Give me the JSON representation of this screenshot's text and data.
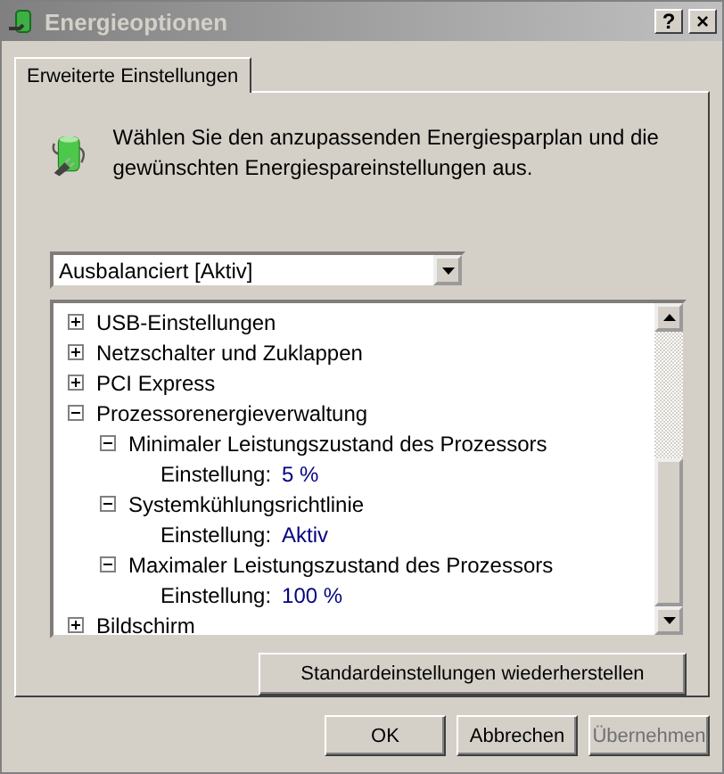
{
  "window": {
    "title": "Energieoptionen",
    "help_button": "?",
    "close_button": "×"
  },
  "tabs": [
    {
      "label": "Erweiterte Einstellungen",
      "selected": true
    }
  ],
  "description": "Wählen Sie den anzupassenden Energiesparplan und die gewünschten Energiespareinstellungen aus.",
  "plan_dropdown": {
    "value": "Ausbalanciert [Aktiv]"
  },
  "tree": [
    {
      "label": "USB-Einstellungen",
      "expanded": false
    },
    {
      "label": "Netzschalter und Zuklappen",
      "expanded": false
    },
    {
      "label": "PCI Express",
      "expanded": false
    },
    {
      "label": "Prozessorenergieverwaltung",
      "expanded": true,
      "children": [
        {
          "label": "Minimaler Leistungszustand des Prozessors",
          "expanded": true,
          "setting": {
            "label": "Einstellung:",
            "value": "5 %"
          }
        },
        {
          "label": "Systemkühlungsrichtlinie",
          "expanded": true,
          "setting": {
            "label": "Einstellung:",
            "value": "Aktiv"
          }
        },
        {
          "label": "Maximaler Leistungszustand des Prozessors",
          "expanded": true,
          "setting": {
            "label": "Einstellung:",
            "value": "100 %"
          }
        }
      ]
    },
    {
      "label": "Bildschirm",
      "expanded": false
    }
  ],
  "restore_button": "Standardeinstellungen wiederherstellen",
  "buttons": [
    {
      "label": "OK",
      "disabled": false
    },
    {
      "label": "Abbrechen",
      "disabled": false
    },
    {
      "label": "Übernehmen",
      "disabled": true
    }
  ]
}
